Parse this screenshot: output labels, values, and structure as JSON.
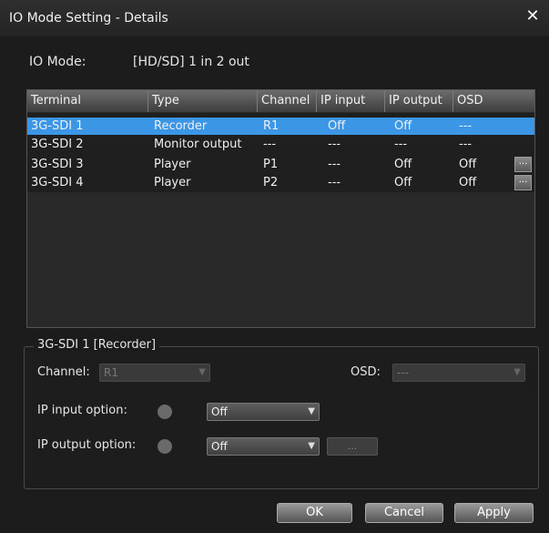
{
  "window": {
    "title": "IO Mode Setting - Details",
    "close_glyph": "✕"
  },
  "io_mode": {
    "label": "IO Mode:",
    "value": "[HD/SD] 1 in 2 out"
  },
  "table": {
    "headers": [
      "Terminal",
      "Type",
      "Channel",
      "IP input",
      "IP output",
      "OSD"
    ],
    "rows": [
      {
        "terminal": "3G-SDI 1",
        "type": "Recorder",
        "channel": "R1",
        "ip_input": "Off",
        "ip_output": "Off",
        "osd": "---",
        "selected": true,
        "has_button": false
      },
      {
        "terminal": "3G-SDI 2",
        "type": "Monitor output",
        "channel": "---",
        "ip_input": "---",
        "ip_output": "---",
        "osd": "---",
        "selected": false,
        "has_button": false
      },
      {
        "terminal": "3G-SDI 3",
        "type": "Player",
        "channel": "P1",
        "ip_input": "---",
        "ip_output": "Off",
        "osd": "Off",
        "selected": false,
        "has_button": true
      },
      {
        "terminal": "3G-SDI 4",
        "type": "Player",
        "channel": "P2",
        "ip_input": "---",
        "ip_output": "Off",
        "osd": "Off",
        "selected": false,
        "has_button": true
      }
    ],
    "row_button_label": "..."
  },
  "details": {
    "group_title": "3G-SDI 1 [Recorder]",
    "channel_label": "Channel:",
    "channel_value": "R1",
    "osd_label": "OSD:",
    "osd_value": "---",
    "ip_input_label": "IP input option:",
    "ip_input_value": "Off",
    "ip_output_label": "IP output option:",
    "ip_output_value": "Off",
    "options_button_label": "..."
  },
  "buttons": {
    "ok": "OK",
    "cancel": "Cancel",
    "apply": "Apply"
  },
  "colors": {
    "selection": "#3b96e6",
    "background": "#1c1c1c"
  }
}
